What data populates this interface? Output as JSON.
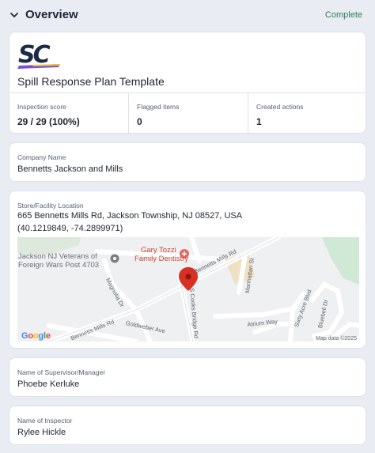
{
  "header": {
    "title": "Overview",
    "status": "Complete",
    "status_color": "#2e7d55",
    "collapse_icon": "chevron-down-icon"
  },
  "template": {
    "logo_text": "SC",
    "title": "Spill Response Plan Template"
  },
  "stats": [
    {
      "label": "Inspection score",
      "value": "29 / 29 (100%)"
    },
    {
      "label": "Flagged items",
      "value": "0"
    },
    {
      "label": "Created actions",
      "value": "1"
    }
  ],
  "company": {
    "label": "Company Name",
    "value": "Bennetts Jackson and Mills"
  },
  "location": {
    "label": "Store/Facility Location",
    "address": "665 Bennetts Mills Rd, Jackson Township, NJ 08527, USA",
    "coords": "(40.1219849, -74.2899971)",
    "map": {
      "poi_vets_line1": "Jackson NJ Veterans of",
      "poi_vets_line2": "Foreign Wars Post 4703",
      "poi_dentist_line1": "Gary Tozzi",
      "poi_dentist_line2": "Family Dentistry",
      "road_bennetts_upper": "Bennetts Mills Rd",
      "road_bennetts_lower": "Bennetts Mills Rd",
      "road_magnolia": "Magnolia Dr",
      "road_goldweber": "Goldweber Ave",
      "road_cooks": "S Cooks Bridge Rd",
      "road_manhattan": "Manhattan St",
      "road_atrium": "Atrium Way",
      "road_sixty_acre": "Sixty Acre Blvd",
      "road_bluebell": "Bluebell Dr",
      "google": "Google",
      "attribution": "Map data ©2025",
      "pin_color": "#d93025"
    }
  },
  "supervisor": {
    "label": "Name of Supervisor/Manager",
    "value": "Phoebe Kerluke"
  },
  "inspector": {
    "label": "Name of Inspector",
    "value": "Rylee Hickle"
  }
}
